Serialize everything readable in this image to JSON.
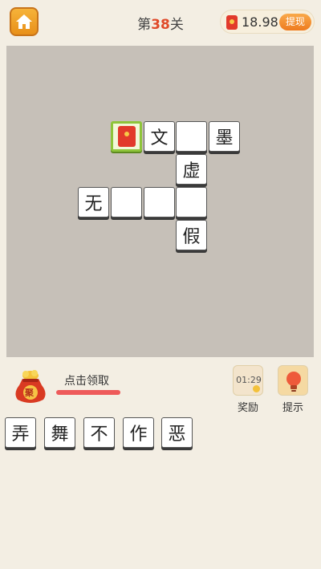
{
  "header": {
    "level_prefix": "第",
    "level_number": "38",
    "level_suffix": "关",
    "balance": "18.98",
    "withdraw_label": "提现"
  },
  "board": {
    "cells": [
      {
        "id": "r1c1",
        "text": "",
        "type": "redpack"
      },
      {
        "id": "r1c2",
        "text": "文"
      },
      {
        "id": "r1c3",
        "text": ""
      },
      {
        "id": "r1c4",
        "text": "墨"
      },
      {
        "id": "r2c3",
        "text": "虚"
      },
      {
        "id": "r3c0",
        "text": "无"
      },
      {
        "id": "r3c1",
        "text": ""
      },
      {
        "id": "r3c2",
        "text": ""
      },
      {
        "id": "r3c3",
        "text": ""
      },
      {
        "id": "r4c3",
        "text": "假"
      }
    ]
  },
  "collect": {
    "bag_text": "聚",
    "label": "点击领取"
  },
  "tools": {
    "reward_timer": "01:29",
    "reward_label": "奖励",
    "hint_label": "提示"
  },
  "options": [
    "弄",
    "舞",
    "不",
    "作",
    "恶"
  ],
  "colors": {
    "accent_orange": "#ee7b1f",
    "level_red": "#e04a2a",
    "select_green": "#8ec43a",
    "board_bg": "#c6c0b8"
  }
}
